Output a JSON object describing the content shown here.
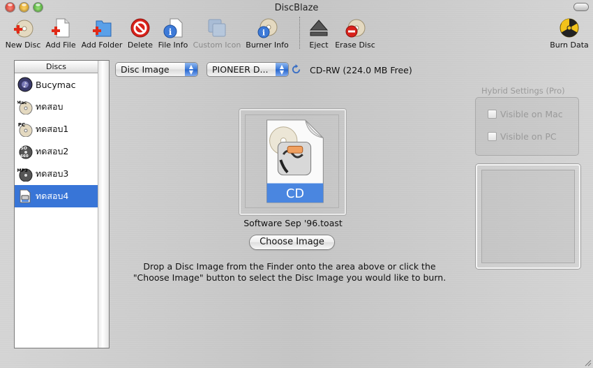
{
  "window": {
    "title": "DiscBlaze"
  },
  "toolbar": {
    "items": [
      {
        "label": "New Disc",
        "icon": "new-disc-icon"
      },
      {
        "label": "Add File",
        "icon": "add-file-icon"
      },
      {
        "label": "Add Folder",
        "icon": "add-folder-icon"
      },
      {
        "label": "Delete",
        "icon": "delete-icon"
      },
      {
        "label": "File Info",
        "icon": "file-info-icon"
      },
      {
        "label": "Custom Icon",
        "icon": "custom-icon-icon",
        "disabled": true
      },
      {
        "label": "Burner Info",
        "icon": "burner-info-icon"
      },
      {
        "label": "Eject",
        "icon": "eject-icon"
      },
      {
        "label": "Erase Disc",
        "icon": "erase-disc-icon"
      },
      {
        "label": "Burn Data",
        "icon": "burn-icon"
      }
    ]
  },
  "sidebar": {
    "header": "Discs",
    "items": [
      {
        "label": "Bucymac",
        "icon": "music-disc-icon",
        "selected": false
      },
      {
        "label": "ทดสอบ",
        "icon": "mac-disc-icon",
        "badge": "Mac",
        "selected": false
      },
      {
        "label": "ทดสอบ1",
        "icon": "pc-disc-icon",
        "badge": "PC",
        "selected": false
      },
      {
        "label": "ทดสอบ2",
        "icon": "iso-disc-icon",
        "badge": "ISO 9660",
        "selected": false
      },
      {
        "label": "ทดสอบ3",
        "icon": "mp3-disc-icon",
        "badge": "MP3",
        "selected": false
      },
      {
        "label": "ทดสอบ4",
        "icon": "disc-image-icon",
        "selected": true
      }
    ]
  },
  "main": {
    "disc_type": "Disc Image",
    "drive": "PIONEER D...",
    "free_space": "CD-RW (224.0 MB Free)",
    "image_badge": "CD",
    "filename": "Software Sep '96.toast",
    "choose_button": "Choose Image",
    "instructions_line1": "Drop a Disc Image from the Finder onto the area above or click the",
    "instructions_line2": "\"Choose Image\" button to select the Disc Image you would like to burn."
  },
  "hybrid": {
    "title": "Hybrid Settings (Pro)",
    "visible_mac": "Visible on Mac",
    "visible_pc": "Visible on PC"
  },
  "colors": {
    "selection": "#3875d7",
    "accent_blue": "#2766cc"
  }
}
